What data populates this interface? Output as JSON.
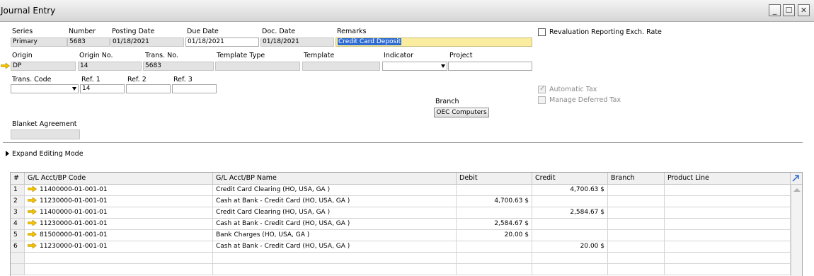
{
  "window": {
    "title": "Journal Entry",
    "minimize": "_",
    "maximize": "☐",
    "close": "✕"
  },
  "header": {
    "series_label": "Series",
    "series_value": "Primary",
    "number_label": "Number",
    "number_value": "5683",
    "posting_date_label": "Posting Date",
    "posting_date_value": "01/18/2021",
    "due_date_label": "Due Date",
    "due_date_value": "01/18/2021",
    "doc_date_label": "Doc. Date",
    "doc_date_value": "01/18/2021",
    "remarks_label": "Remarks",
    "remarks_value": "Credit Card Deposit",
    "revaluation_label": "Revaluation Reporting Exch. Rate",
    "origin_label": "Origin",
    "origin_value": "DP",
    "origin_no_label": "Origin No.",
    "origin_no_value": "14",
    "trans_no_label": "Trans. No.",
    "trans_no_value": "5683",
    "template_type_label": "Template Type",
    "template_type_value": "",
    "template_label": "Template",
    "template_value": "",
    "indicator_label": "Indicator",
    "indicator_value": "",
    "project_label": "Project",
    "project_value": "",
    "trans_code_label": "Trans. Code",
    "trans_code_value": "",
    "ref1_label": "Ref. 1",
    "ref1_value": "14",
    "ref2_label": "Ref. 2",
    "ref2_value": "",
    "ref3_label": "Ref. 3",
    "ref3_value": "",
    "automatic_tax_label": "Automatic Tax",
    "manage_deferred_tax_label": "Manage Deferred Tax",
    "branch_label": "Branch",
    "branch_value": "OEC Computers",
    "blanket_agreement_label": "Blanket Agreement",
    "blanket_agreement_value": ""
  },
  "expand_editing_mode_label": "Expand Editing Mode",
  "table": {
    "columns": [
      "#",
      "G/L Acct/BP Code",
      "G/L Acct/BP Name",
      "Debit",
      "Credit",
      "Branch",
      "Product Line"
    ],
    "rows": [
      {
        "n": "1",
        "code": "11400000-01-001-01",
        "name": "Credit Card Clearing (HO, USA, GA )",
        "debit": "",
        "credit": "4,700.63 $",
        "branch": "",
        "product_line": ""
      },
      {
        "n": "2",
        "code": "11230000-01-001-01",
        "name": "Cash at Bank - Credit Card (HO, USA, GA )",
        "debit": "4,700.63 $",
        "credit": "",
        "branch": "",
        "product_line": ""
      },
      {
        "n": "3",
        "code": "11400000-01-001-01",
        "name": "Credit Card Clearing (HO, USA, GA )",
        "debit": "",
        "credit": "2,584.67 $",
        "branch": "",
        "product_line": ""
      },
      {
        "n": "4",
        "code": "11230000-01-001-01",
        "name": "Cash at Bank - Credit Card (HO, USA, GA )",
        "debit": "2,584.67 $",
        "credit": "",
        "branch": "",
        "product_line": ""
      },
      {
        "n": "5",
        "code": "81500000-01-001-01",
        "name": "Bank Charges (HO, USA, GA )",
        "debit": "20.00 $",
        "credit": "",
        "branch": "",
        "product_line": ""
      },
      {
        "n": "6",
        "code": "11230000-01-001-01",
        "name": "Cash at Bank - Credit Card (HO, USA, GA )",
        "debit": "",
        "credit": "20.00 $",
        "branch": "",
        "product_line": ""
      }
    ]
  },
  "colors": {
    "link_arrow": "#f2c200",
    "selection": "#2c6ad3",
    "remarks_highlight": "#fbeda0"
  },
  "icons": {
    "link_arrow": "orange-link-arrow-icon",
    "expand": "expand-table-icon",
    "expand_triangle": "triangle-right-icon"
  }
}
